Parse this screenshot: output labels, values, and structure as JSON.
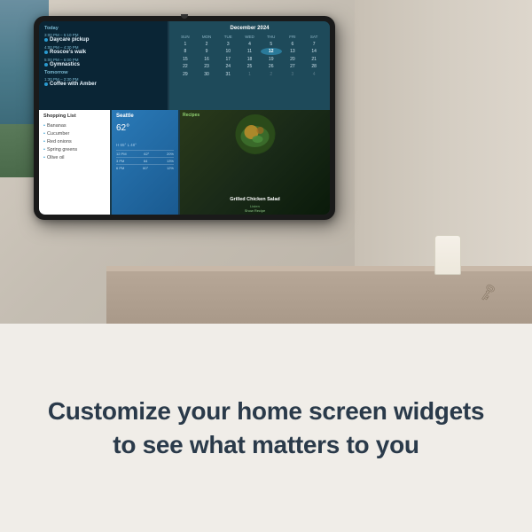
{
  "device": {
    "camera_label": "camera"
  },
  "calendar": {
    "month": "December 2024",
    "day_headers": [
      "SUN",
      "MON",
      "TUE",
      "WED",
      "THU",
      "FRI",
      "SAT"
    ],
    "days_row1": [
      "1",
      "2",
      "3",
      "4",
      "5",
      "6",
      "7"
    ],
    "days_row2": [
      "8",
      "9",
      "10",
      "11",
      "12",
      "13",
      "14"
    ],
    "days_row3": [
      "15",
      "16",
      "17",
      "18",
      "19",
      "20",
      "21"
    ],
    "days_row4": [
      "22",
      "23",
      "24",
      "25",
      "26",
      "27",
      "28"
    ],
    "days_row5": [
      "29",
      "30",
      "31",
      "1",
      "2",
      "3",
      "4"
    ],
    "today": "12"
  },
  "events": {
    "today_label": "Today",
    "event1_time": "3:00 PM – 5:10 PM",
    "event1_title": "Daycare pickup",
    "event2_time": "4:00 PM – 4:30 PM",
    "event2_title": "Roscoe's walk",
    "event3_time": "5:00 PM – 6:00 PM",
    "event3_title": "Gymnastics",
    "tomorrow_label": "Tomorrow",
    "event4_time": "1:30 PM – 2:30 PM",
    "event4_title": "Coffee with Amber"
  },
  "shopping": {
    "title": "Shopping List",
    "items": [
      "Bananas",
      "Cucumber",
      "Red onions",
      "Spring greens",
      "Olive oil"
    ]
  },
  "weather": {
    "city": "Seattle",
    "temperature": "62",
    "unit": "°",
    "high": "H 65°",
    "low": "L 48°",
    "forecast": [
      {
        "time": "12 PM",
        "temp": "62°",
        "precip": "20%"
      },
      {
        "time": "3 PM",
        "temp": "64",
        "precip": "13%"
      },
      {
        "time": "6 PM",
        "temp": "60°",
        "precip": "12%"
      }
    ]
  },
  "recipe": {
    "header": "Recipes",
    "title": "Grilled Chicken Salad",
    "listen": "Listen",
    "show": "Show Recipe"
  },
  "tagline": {
    "text": "Customize your home screen widgets to see what matters to you"
  }
}
